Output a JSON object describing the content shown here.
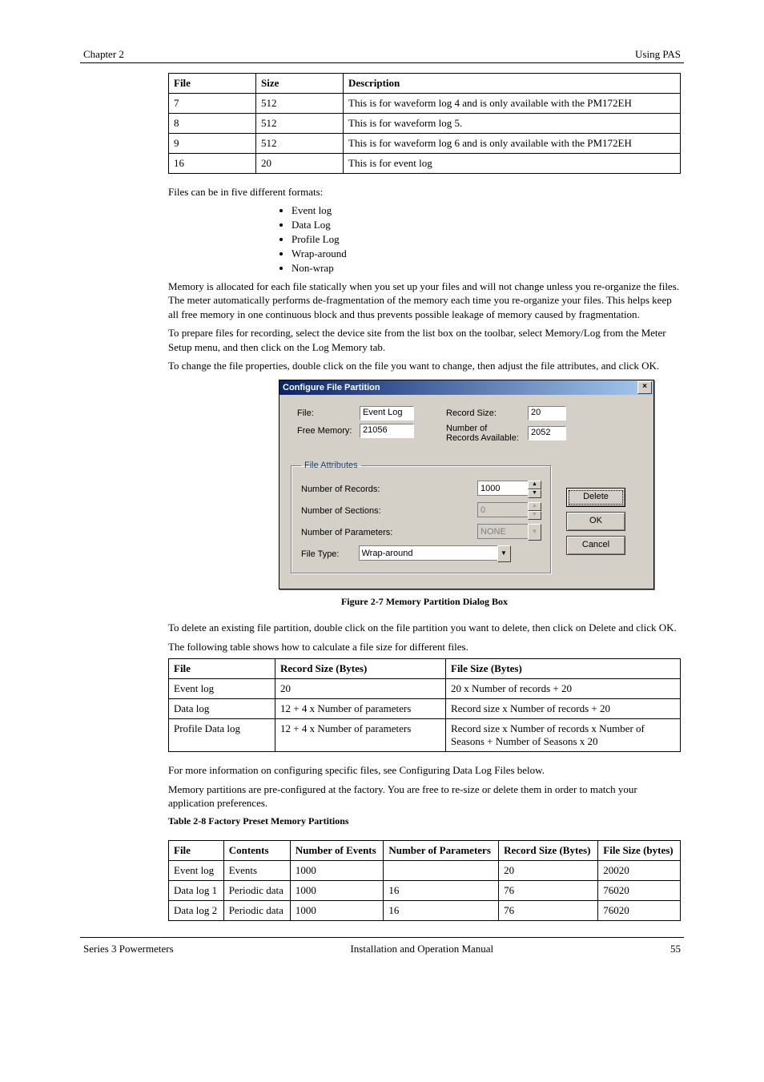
{
  "header": {
    "left": "Chapter 2",
    "right": "Using PAS"
  },
  "footer": {
    "left": "Series 3 Powermeters",
    "center": "Installation and Operation Manual",
    "right": "55"
  },
  "table": {
    "cols": [
      "File",
      "Size",
      "Description"
    ],
    "rows": [
      [
        "7",
        "512",
        "This is for waveform log 4 and is only available with the PM172EH"
      ],
      [
        "8",
        "512",
        "This is for waveform log 5."
      ],
      [
        "9",
        "512",
        "This is for waveform log 6 and is only available with the PM172EH"
      ],
      [
        "16",
        "20",
        "This is for event log"
      ]
    ]
  },
  "para1": "Memory is allocated for each file statically when you set up your files and will not change unless you re-organize the files. The meter automatically performs de-fragmentation of the memory each time you re-organize your files. This helps keep all free memory in one continuous block and thus prevents possible leakage of memory caused by fragmentation.",
  "para2": "To prepare files for recording, select the device site from the list box on the toolbar, select Memory/Log from the Meter Setup menu, and then click on the Log Memory tab.",
  "para3": "To change the file properties, double click on the file you want to change, then adjust the file attributes, and click OK.",
  "list": {
    "intro": "Files can be in five different formats:",
    "items": [
      "Event log",
      "Data Log",
      "Profile Log",
      "Wrap-around",
      "Non-wrap"
    ]
  },
  "dialog": {
    "title": "Configure File Partition",
    "labels": {
      "file": "File:",
      "free_memory": "Free Memory:",
      "record_size": "Record Size:",
      "num_records_avail": "Number of Records Available:",
      "file_attributes": "File Attributes",
      "num_records": "Number of Records:",
      "num_sections": "Number of Sections:",
      "num_params": "Number of Parameters:",
      "file_type": "File Type:"
    },
    "values": {
      "file": "Event Log",
      "free_memory": "21056",
      "record_size": "20",
      "num_records_avail": "2052",
      "num_records": "1000",
      "num_sections": "0",
      "num_params": "NONE",
      "file_type": "Wrap-around"
    },
    "buttons": {
      "delete": "Delete",
      "ok": "OK",
      "cancel": "Cancel"
    },
    "close": "×"
  },
  "caption_a": "Figure 2-7 Memory Partition Dialog Box",
  "para4": "To delete an existing file partition, double click on the file partition you want to delete, then click on Delete and click OK.",
  "para5": "The following table shows how to calculate a file size for different files.",
  "extra_table": {
    "cols": [
      "File",
      "Record Size (Bytes)",
      "File Size (Bytes)"
    ],
    "rows": [
      [
        "Event log",
        "20",
        "20 x Number of records + 20"
      ],
      [
        "Data log",
        "12 + 4 x Number of parameters",
        "Record size x Number of records + 20"
      ],
      [
        "Profile Data log",
        "12 + 4 x Number of parameters",
        "Record size x Number of records x Number of Seasons + Number of Seasons x 20"
      ]
    ]
  },
  "para6": "For more information on configuring specific files, see Configuring Data Log Files below.",
  "para7": "Memory partitions are pre-configured at the factory. You are free to re-size or delete them in order to match your application preferences.",
  "caption_b": "Table 2-8 Factory Preset Memory Partitions",
  "preset_table": {
    "cols": [
      "File",
      "Contents",
      "Number of Events",
      "Number of Parameters",
      "Record Size (Bytes)",
      "File Size (bytes)"
    ],
    "rows": [
      [
        "Event log",
        "Events",
        "1000",
        "",
        "20",
        "20020"
      ],
      [
        "Data log 1",
        "Periodic data",
        "1000",
        "16",
        "76",
        "76020"
      ],
      [
        "Data log 2",
        "Periodic data",
        "1000",
        "16",
        "76",
        "76020"
      ]
    ]
  }
}
